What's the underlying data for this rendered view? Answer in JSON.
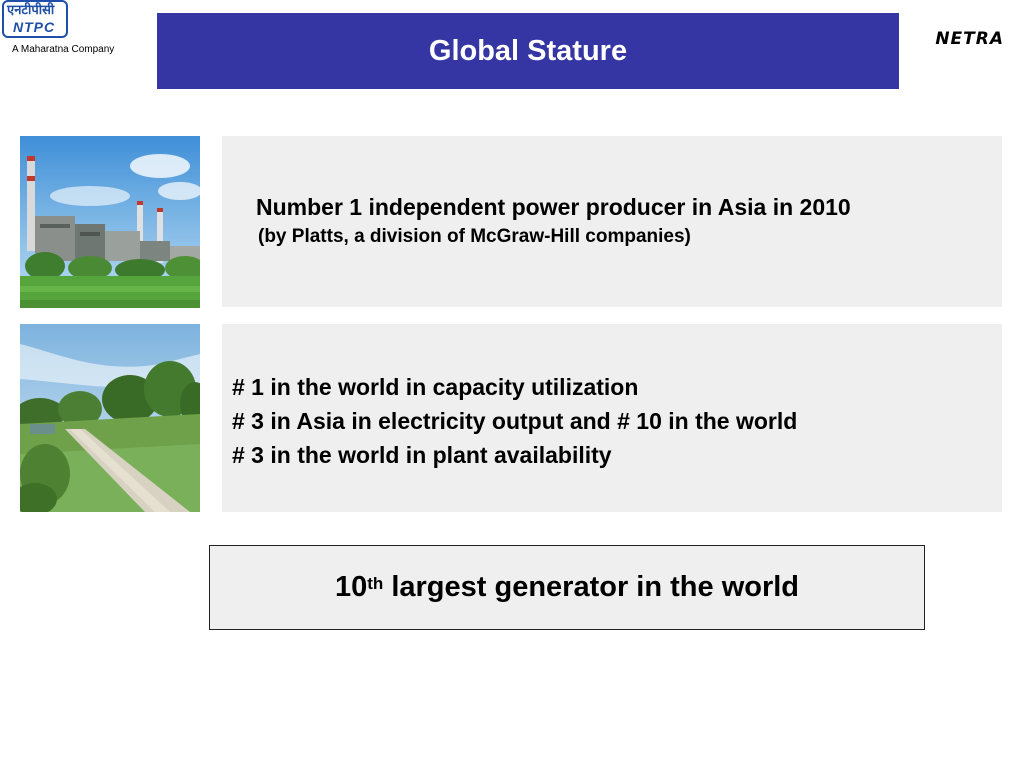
{
  "logo": {
    "devanagari": "एनटीपीसी",
    "latin": "NTPC",
    "tagline": "A Maharatna Company"
  },
  "header": {
    "title": "Global Stature",
    "brand": "NETRA"
  },
  "photos": [
    {
      "subject": "power-plant-chimneys"
    },
    {
      "subject": "green-pathway-landscape"
    }
  ],
  "panel1": {
    "headline": "Number 1 independent power producer in Asia in 2010",
    "subline": "(by Platts, a  division of McGraw-Hill companies)"
  },
  "panel2": {
    "items": [
      "# 1 in the world in capacity utilization",
      "# 3 in Asia in electricity output and # 10 in the world",
      "# 3 in the world in plant availability"
    ]
  },
  "callout": {
    "number": "10",
    "suffix": "th",
    "text": " largest generator in the world"
  },
  "colors": {
    "title_bar": "#3535a3",
    "panel_bg": "#efefef",
    "logo_blue": "#1f4fa8"
  }
}
